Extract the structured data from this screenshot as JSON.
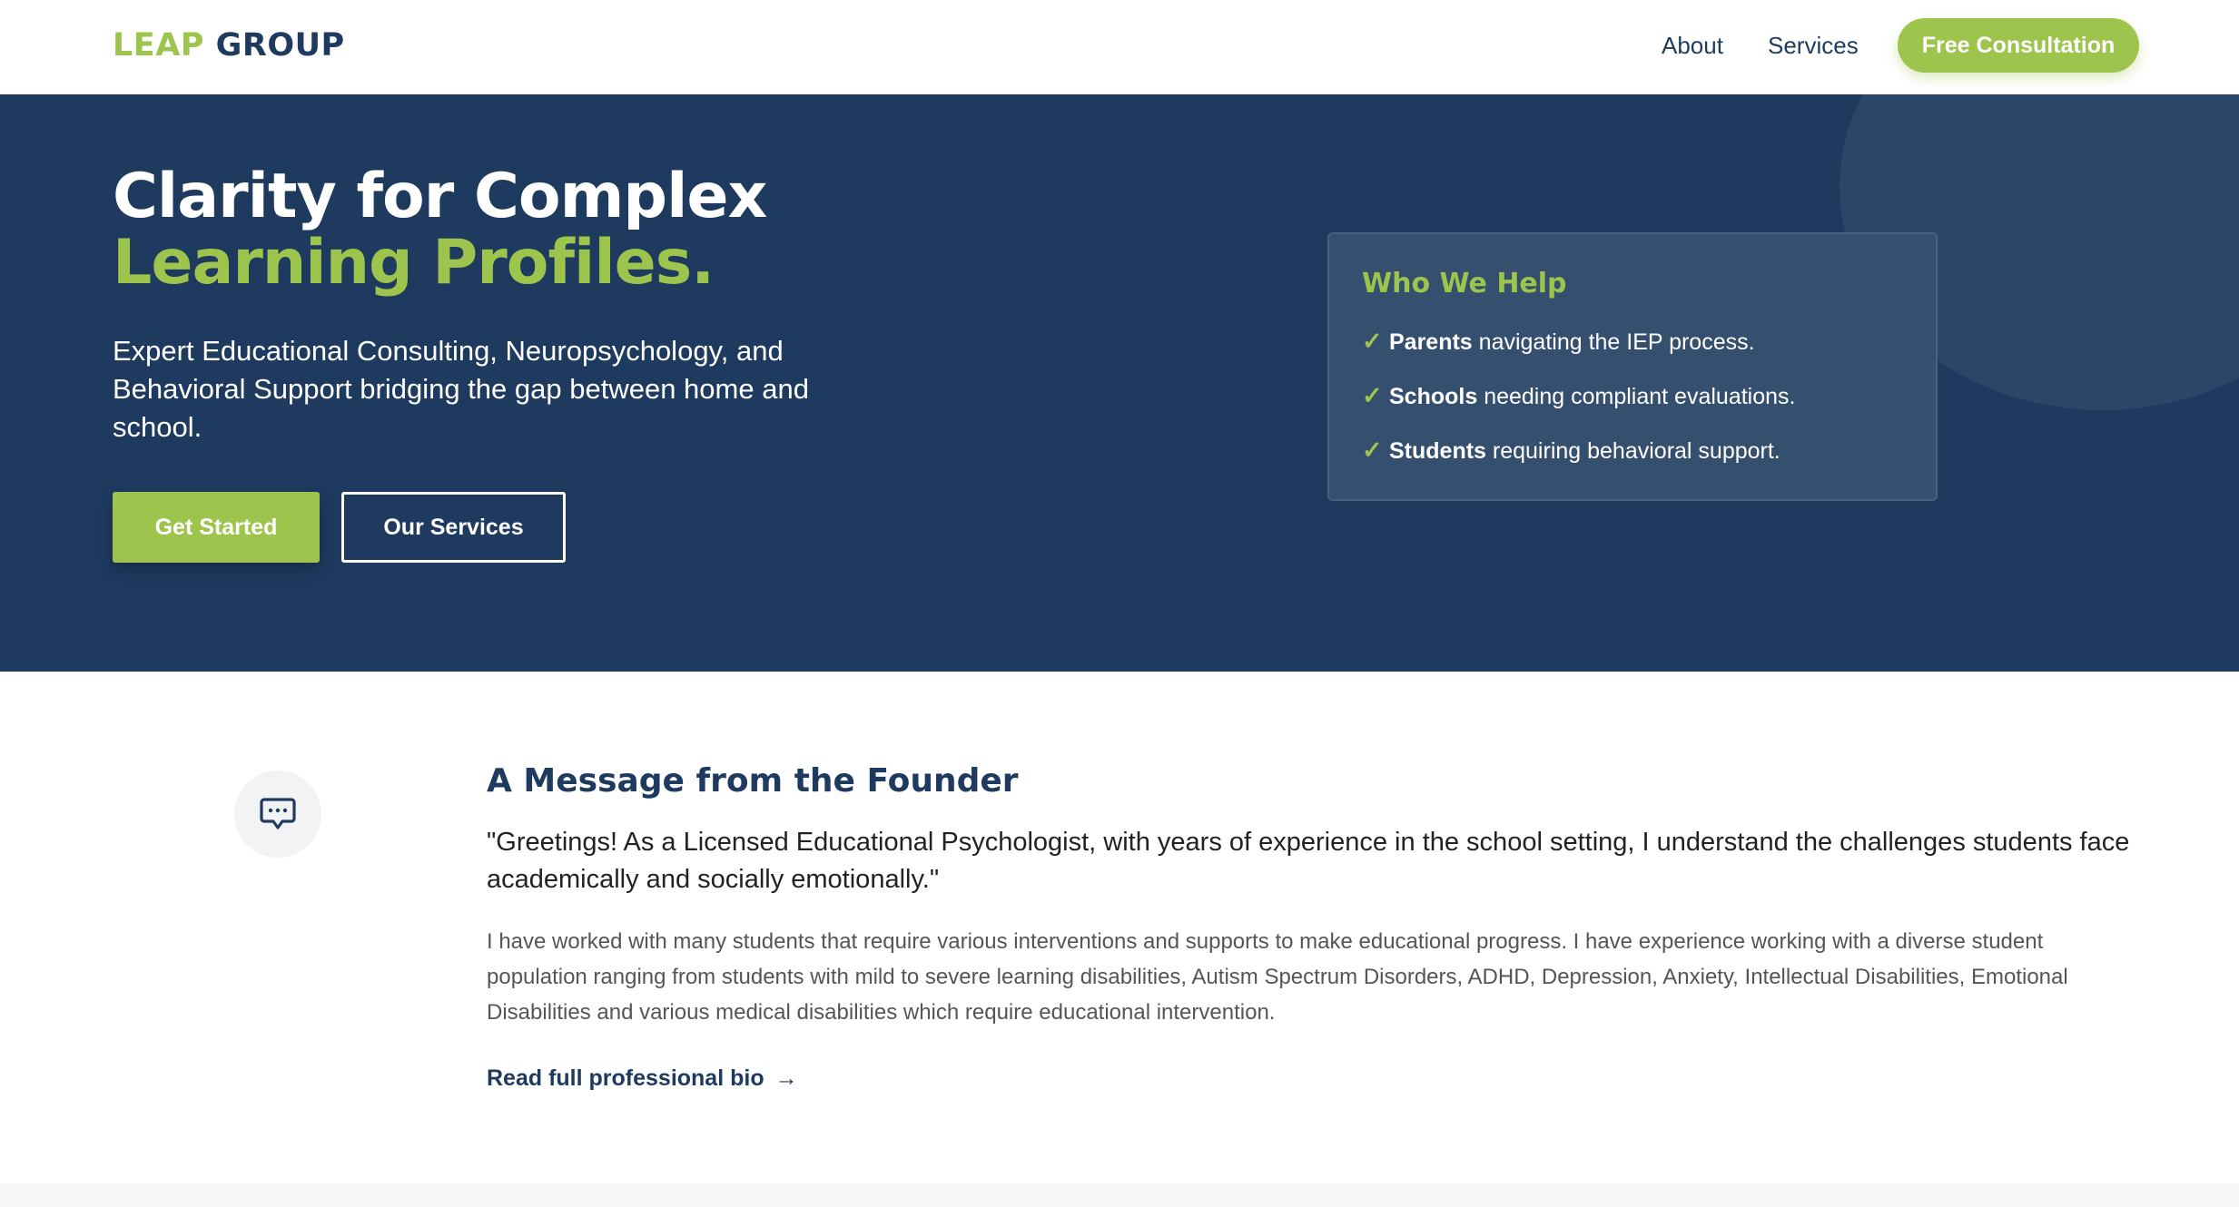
{
  "nav": {
    "logo_part1": "LEAP",
    "logo_part2": "GROUP",
    "links": [
      "About",
      "Services"
    ],
    "cta": "Free Consultation"
  },
  "hero": {
    "title_line1": "Clarity for Complex",
    "title_line2": "Learning Profiles.",
    "subtitle": "Expert Educational Consulting, Neuropsychology, and Behavioral Support bridging the gap between home and school.",
    "primary_button": "Get Started",
    "secondary_button": "Our Services"
  },
  "help_card": {
    "title": "Who We Help",
    "items": [
      {
        "bold": "Parents",
        "text": " navigating the IEP process."
      },
      {
        "bold": "Schools",
        "text": " needing compliant evaluations."
      },
      {
        "bold": "Students",
        "text": " requiring behavioral support."
      }
    ]
  },
  "founder": {
    "icon": "chat-bubble-icon",
    "title": "A Message from the Founder",
    "quote": "\"Greetings! As a Licensed Educational Psychologist, with years of experience in the school setting, I understand the challenges students face academically and socially emotionally.\"",
    "body": "I have worked with many students that require various interventions and supports to make educational progress. I have experience working with a diverse student population ranging from students with mild to severe learning disabilities, Autism Spectrum Disorders, ADHD, Depression, Anxiety, Intellectual Disabilities, Emotional Disabilities and various medical disabilities which require educational intervention.",
    "link": "Read full professional bio",
    "link_arrow": "→"
  },
  "colors": {
    "navy": "#1e3a5f",
    "green": "#9dc44d",
    "card": "#354f6f"
  }
}
